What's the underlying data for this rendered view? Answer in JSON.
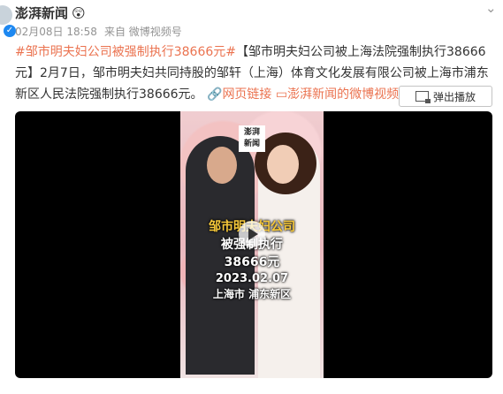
{
  "post": {
    "author": "澎湃新闻",
    "author_emoji": "😲",
    "verified_mark": "✓",
    "more_icon": "chevron-down-icon",
    "timestamp": "02月08日 18:58",
    "source": "来自 微博视频号",
    "hashtag": "#邹市明夫妇公司被强制执行38666元#",
    "body": "【邹市明夫妇公司被上海法院强制执行38666元】2月7日，邹市明夫妇共同持股的邹轩（上海）体育文化发展有限公司被上海市浦东新区人民法院强制执行38666元。",
    "web_link": "网页链接",
    "video_link": "澎湃新闻的微博视频",
    "popout_button": "弹出播放"
  },
  "video": {
    "logo": "澎湃\n新闻",
    "overlay_line1": "邹市明夫妇公司",
    "overlay_line2": "被强制执行",
    "overlay_line3": "38666元",
    "overlay_date": "2023.02.07",
    "overlay_place": "上海市 浦东新区"
  },
  "colors": {
    "link": "#eb7350",
    "verified": "#1d88f1"
  }
}
